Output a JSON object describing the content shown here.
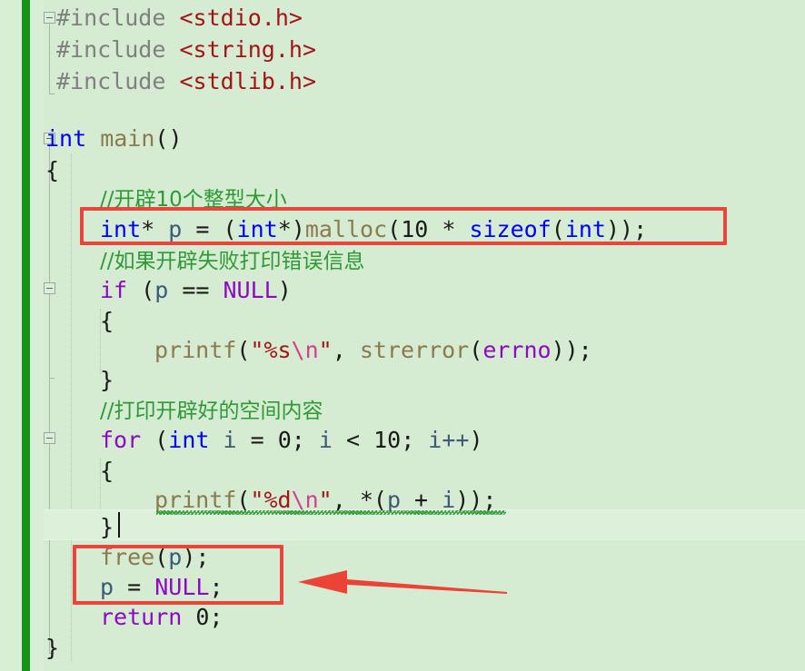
{
  "editor": {
    "app": "visual-studio-code-editor",
    "language": "c",
    "background_color": "#d5ecd2",
    "current_line_highlight_color": "#dcf0da",
    "unsaved_marker_color": "#159318",
    "annotation_color": "#e8453c"
  },
  "code_lines": [
    {
      "n": 1,
      "indent": 0,
      "text": "#include <stdio.h>"
    },
    {
      "n": 2,
      "indent": 0,
      "text": "#include <string.h>"
    },
    {
      "n": 3,
      "indent": 0,
      "text": "#include <stdlib.h>"
    },
    {
      "n": 4,
      "indent": 0,
      "text": ""
    },
    {
      "n": 5,
      "indent": 0,
      "text": "int main()"
    },
    {
      "n": 6,
      "indent": 0,
      "text": "{"
    },
    {
      "n": 7,
      "indent": 1,
      "text": "//开辟10个整型大小"
    },
    {
      "n": 8,
      "indent": 1,
      "text": "int* p = (int*)malloc(10 * sizeof(int));"
    },
    {
      "n": 9,
      "indent": 1,
      "text": "//如果开辟失败打印错误信息"
    },
    {
      "n": 10,
      "indent": 1,
      "text": "if (p == NULL)"
    },
    {
      "n": 11,
      "indent": 1,
      "text": "{"
    },
    {
      "n": 12,
      "indent": 2,
      "text": "printf(\"%s\\n\", strerror(errno));"
    },
    {
      "n": 13,
      "indent": 1,
      "text": "}"
    },
    {
      "n": 14,
      "indent": 1,
      "text": "//打印开辟好的空间内容"
    },
    {
      "n": 15,
      "indent": 1,
      "text": "for (int i = 0; i < 10; i++)"
    },
    {
      "n": 16,
      "indent": 1,
      "text": "{"
    },
    {
      "n": 17,
      "indent": 2,
      "text": "printf(\"%d\\n\", *(p + i));"
    },
    {
      "n": 18,
      "indent": 1,
      "text": "}"
    },
    {
      "n": 19,
      "indent": 1,
      "text": "free(p);"
    },
    {
      "n": 20,
      "indent": 1,
      "text": "p = NULL;"
    },
    {
      "n": 21,
      "indent": 1,
      "text": "return 0;"
    },
    {
      "n": 22,
      "indent": 0,
      "text": "}"
    }
  ],
  "tokens": {
    "l1": {
      "hash_include": "#include",
      "header": "<stdio.h>"
    },
    "l2": {
      "hash_include": "#include",
      "header": "<string.h>"
    },
    "l3": {
      "hash_include": "#include",
      "header": "<stdlib.h>"
    },
    "l5": {
      "kw_int": "int",
      "fn_main": " main",
      "parens": "()"
    },
    "l6": {
      "brace": "{"
    },
    "l7": {
      "comment": "//开辟10个整型大小"
    },
    "l8": {
      "kw_int": "int",
      "star_sp": "* ",
      "var_p": "p",
      "assign": " = ",
      "cast_open": "(",
      "cast_int": "int",
      "cast_close": "*)",
      "fn_malloc": "malloc",
      "open": "(",
      "num10": "10",
      "mul": " * ",
      "kw_sizeof": "sizeof",
      "sz_open": "(",
      "sz_int": "int",
      "tail": "));"
    },
    "l9": {
      "comment": "//如果开辟失败打印错误信息"
    },
    "l10": {
      "kw_if": "if",
      "sp_open": " (",
      "var_p": "p",
      "eq": " == ",
      "macro_null": "NULL",
      "close": ")"
    },
    "l11": {
      "brace": "{"
    },
    "l12": {
      "fn_printf": "printf",
      "open": "(",
      "q1": "\"",
      "spec": "%s",
      "esc": "\\n",
      "q2": "\"",
      "comma": ", ",
      "fn_strerror": "strerror",
      "open2": "(",
      "macro_errno": "errno",
      "tail": "));"
    },
    "l13": {
      "brace": "}"
    },
    "l14": {
      "comment": "//打印开辟好的空间内容"
    },
    "l15": {
      "kw_for": "for",
      "sp_open": " (",
      "kw_int": "int",
      "var_i": " i",
      "assign": " = ",
      "num0": "0",
      "semi": "; ",
      "var_i2": "i",
      "lt": " < ",
      "num10": "10",
      "semi2": "; ",
      "inc": "i++",
      "close": ")"
    },
    "l16": {
      "brace": "{"
    },
    "l17": {
      "fn_printf": "printf",
      "open": "(",
      "q1": "\"",
      "spec": "%d",
      "esc": "\\n",
      "q2": "\"",
      "comma": ", ",
      "deref": "*(",
      "var_p": "p",
      "plus": " + ",
      "var_i": "i",
      "tail": "));"
    },
    "l18": {
      "brace": "}"
    },
    "l19": {
      "fn_free": "free",
      "open": "(",
      "var_p": "p",
      "tail": ");"
    },
    "l20": {
      "var_p": "p",
      "assign": " = ",
      "macro_null": "NULL",
      "semi": ";"
    },
    "l21": {
      "kw_return": "return",
      "num0": " 0",
      "semi": ";"
    },
    "l22": {
      "brace": "}"
    }
  },
  "annotations": {
    "box_malloc": {
      "label": "malloc-line-highlight-box",
      "color": "#e8453c",
      "target_text": "int* p = (int*)malloc(10 * sizeof(int));"
    },
    "box_free_null": {
      "label": "free-and-null-highlight-box",
      "color": "#e8453c",
      "target_text": "free(p); p = NULL;"
    },
    "arrow": {
      "label": "pointer-arrow-to-free-block",
      "direction": "left",
      "color": "#e8453c"
    }
  }
}
